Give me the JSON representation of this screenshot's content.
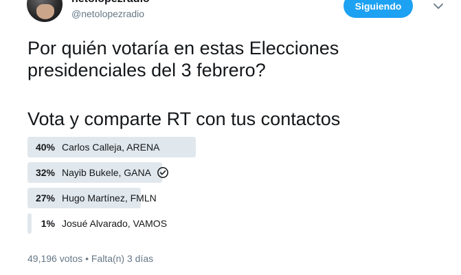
{
  "author": {
    "display_name": "netolopezradio",
    "handle": "@netolopezradio"
  },
  "follow_button": {
    "label": "Siguiendo"
  },
  "tweet": {
    "text_line1": "Por quién votaría en estas  Elecciones\npresidenciales del 3 febrero?",
    "text_line2": "Vota y comparte RT con tus contactos"
  },
  "poll": {
    "options": [
      {
        "percent_label": "40%",
        "label": "Carlos Calleja, ARENA",
        "share": 0.4,
        "selected": false
      },
      {
        "percent_label": "32%",
        "label": "Nayib Bukele, GANA",
        "share": 0.32,
        "selected": true
      },
      {
        "percent_label": "27%",
        "label": "Hugo Martínez, FMLN",
        "share": 0.27,
        "selected": false
      },
      {
        "percent_label": "1%",
        "label": "Josué Alvarado, VAMOS",
        "share": 0.01,
        "selected": false
      }
    ],
    "votes": "49,196 votos",
    "separator": "•",
    "time_left": "Falta(n) 3 días"
  },
  "icons": {
    "caret": "chevron-down-icon",
    "voted": "check-circle-icon"
  },
  "colors": {
    "accent": "#1da1f2",
    "bar": "#e1e8ed",
    "muted": "#657786"
  }
}
